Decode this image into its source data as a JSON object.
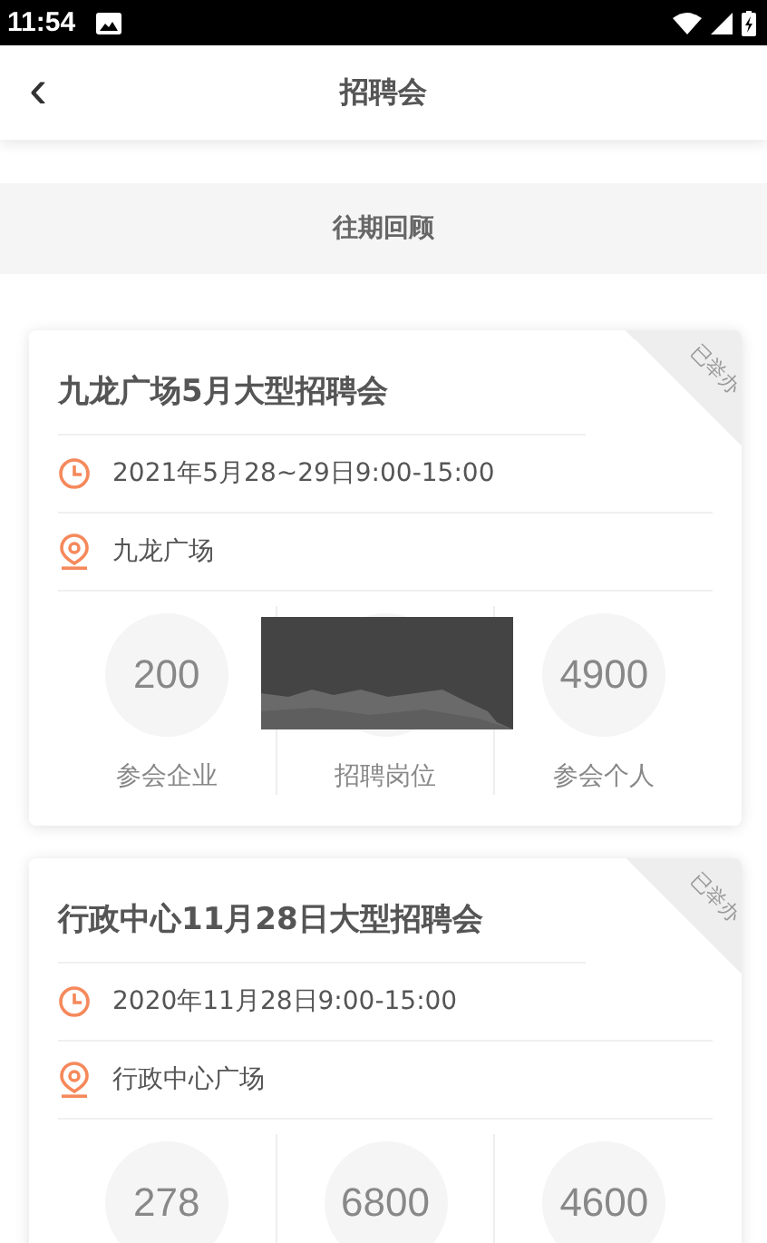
{
  "status_bar": {
    "time": "11:54"
  },
  "header": {
    "back": "‹",
    "title": "招聘会"
  },
  "section": {
    "title": "往期回顾"
  },
  "cards": [
    {
      "title": "九龙广场5月大型招聘会",
      "time": "2021年5月28~29日9:00-15:00",
      "location": "九龙广场",
      "badge": "已举办",
      "stats": [
        {
          "value": "200",
          "label": "参会企业"
        },
        {
          "label": "招聘岗位"
        },
        {
          "value": "4900",
          "label": "参会个人"
        }
      ]
    },
    {
      "title": "行政中心11月28日大型招聘会",
      "time": "2020年11月28日9:00-15:00",
      "location": "行政中心广场",
      "badge": "已举办",
      "stats": [
        {
          "value": "278"
        },
        {
          "value": "6800"
        },
        {
          "value": "4600"
        }
      ]
    }
  ]
}
